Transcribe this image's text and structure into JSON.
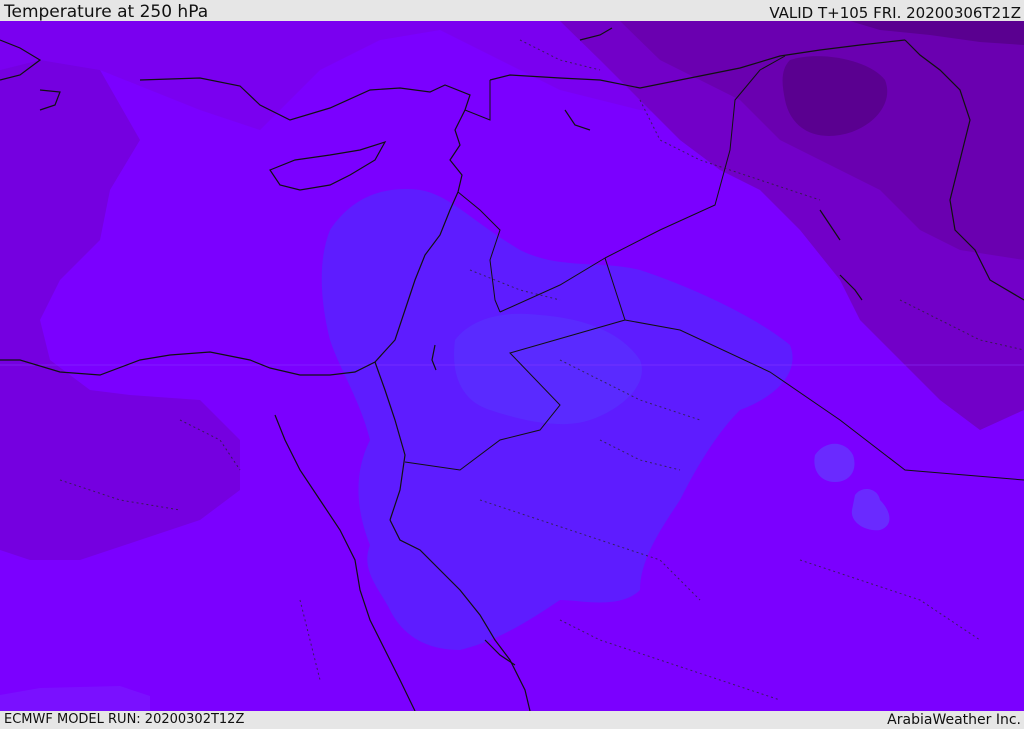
{
  "header": {
    "title": "Temperature at 250 hPa",
    "valid": "VALID T+105 FRI. 20200306T21Z"
  },
  "footer": {
    "model_run": "ECMWF MODEL RUN: 20200302T12Z",
    "credit": "ArabiaWeather Inc."
  },
  "colors": {
    "background_field": "#7b00ff",
    "western_warm_band": "#7500e0",
    "northern_band": "#7a00f0",
    "ne_band": "#7200c8",
    "ne_darker": "#6a00b0",
    "ne_darkest": "#5a0090",
    "cold_core": "#5e1cff",
    "cold_core_inner": "#5a2aff",
    "coastline": "#111111"
  }
}
